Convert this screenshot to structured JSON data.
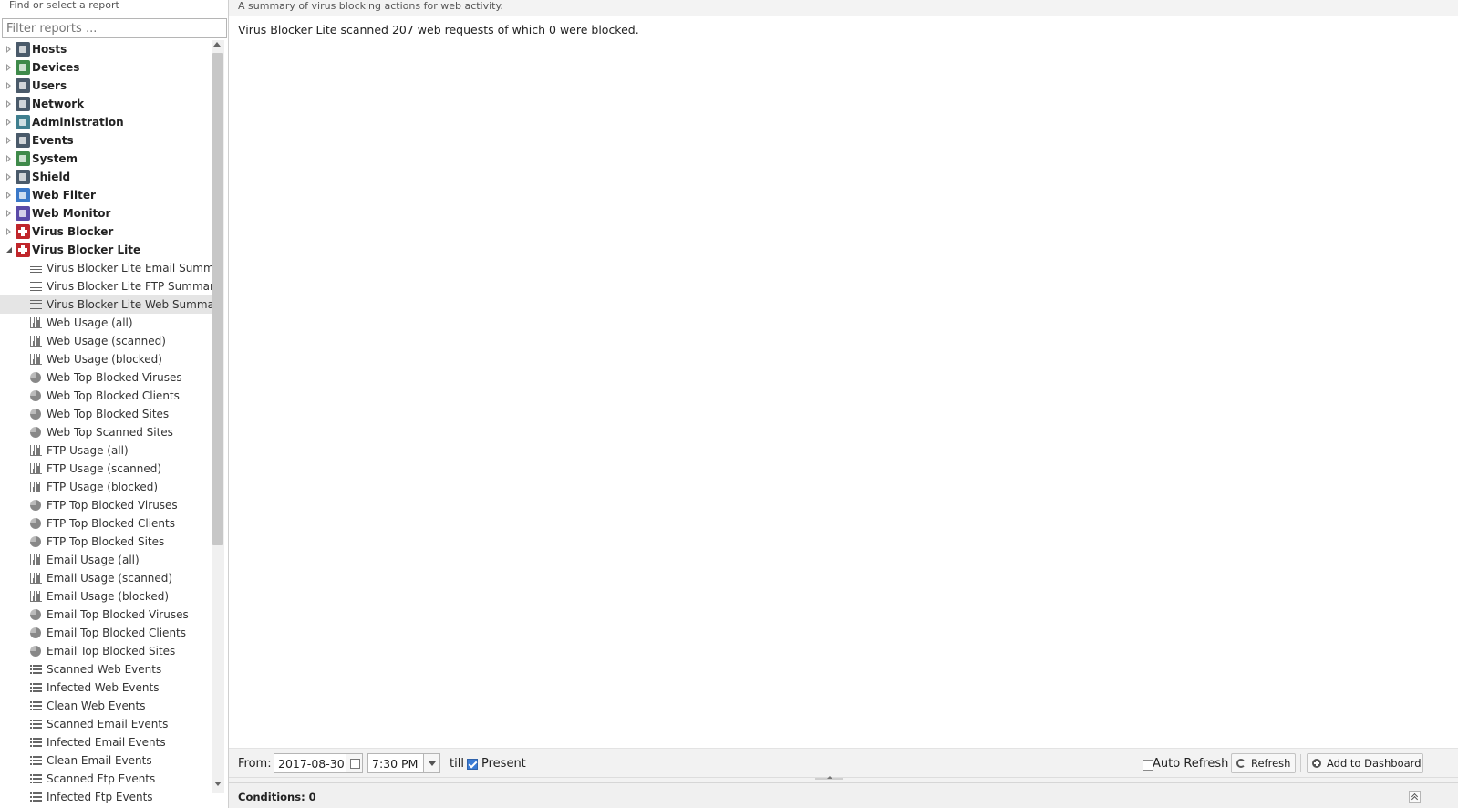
{
  "sidebar": {
    "header": "Find or select a report",
    "filter_placeholder": "Filter reports ...",
    "categories": [
      {
        "label": "Hosts",
        "icon": "hosts-icon"
      },
      {
        "label": "Devices",
        "icon": "devices-icon"
      },
      {
        "label": "Users",
        "icon": "users-icon"
      },
      {
        "label": "Network",
        "icon": "network-icon"
      },
      {
        "label": "Administration",
        "icon": "administration-icon"
      },
      {
        "label": "Events",
        "icon": "events-icon"
      },
      {
        "label": "System",
        "icon": "system-icon"
      },
      {
        "label": "Shield",
        "icon": "shield-icon"
      },
      {
        "label": "Web Filter",
        "icon": "web-filter-icon"
      },
      {
        "label": "Web Monitor",
        "icon": "web-monitor-icon"
      },
      {
        "label": "Virus Blocker",
        "icon": "virus-blocker-icon"
      },
      {
        "label": "Virus Blocker Lite",
        "icon": "virus-blocker-lite-icon",
        "expanded": true
      }
    ],
    "reports": [
      {
        "label": "Virus Blocker Lite Email Summary",
        "type": "text"
      },
      {
        "label": "Virus Blocker Lite FTP Summary",
        "type": "text"
      },
      {
        "label": "Virus Blocker Lite Web Summary",
        "type": "text",
        "selected": true
      },
      {
        "label": "Web Usage (all)",
        "type": "bar"
      },
      {
        "label": "Web Usage (scanned)",
        "type": "bar"
      },
      {
        "label": "Web Usage (blocked)",
        "type": "bar"
      },
      {
        "label": "Web Top Blocked Viruses",
        "type": "pie"
      },
      {
        "label": "Web Top Blocked Clients",
        "type": "pie"
      },
      {
        "label": "Web Top Blocked Sites",
        "type": "pie"
      },
      {
        "label": "Web Top Scanned Sites",
        "type": "pie"
      },
      {
        "label": "FTP Usage (all)",
        "type": "bar"
      },
      {
        "label": "FTP Usage (scanned)",
        "type": "bar"
      },
      {
        "label": "FTP Usage (blocked)",
        "type": "bar"
      },
      {
        "label": "FTP Top Blocked Viruses",
        "type": "pie"
      },
      {
        "label": "FTP Top Blocked Clients",
        "type": "pie"
      },
      {
        "label": "FTP Top Blocked Sites",
        "type": "pie"
      },
      {
        "label": "Email Usage (all)",
        "type": "bar"
      },
      {
        "label": "Email Usage (scanned)",
        "type": "bar"
      },
      {
        "label": "Email Usage (blocked)",
        "type": "bar"
      },
      {
        "label": "Email Top Blocked Viruses",
        "type": "pie"
      },
      {
        "label": "Email Top Blocked Clients",
        "type": "pie"
      },
      {
        "label": "Email Top Blocked Sites",
        "type": "pie"
      },
      {
        "label": "Scanned Web Events",
        "type": "list"
      },
      {
        "label": "Infected Web Events",
        "type": "list"
      },
      {
        "label": "Clean Web Events",
        "type": "list"
      },
      {
        "label": "Scanned Email Events",
        "type": "list"
      },
      {
        "label": "Infected Email Events",
        "type": "list"
      },
      {
        "label": "Clean Email Events",
        "type": "list"
      },
      {
        "label": "Scanned Ftp Events",
        "type": "list"
      },
      {
        "label": "Infected Ftp Events",
        "type": "list"
      }
    ]
  },
  "main": {
    "description": "A summary of virus blocking actions for web activity.",
    "summary": "Virus Blocker Lite scanned 207 web requests of which 0 were blocked."
  },
  "toolbar": {
    "from_label": "From:",
    "from_date": "2017-08-30",
    "from_time": "7:30 PM",
    "till_label": "till",
    "present_label": "Present",
    "present_checked": true,
    "auto_refresh_label": "Auto Refresh",
    "auto_refresh_checked": false,
    "refresh_label": "Refresh",
    "add_dashboard_label": "Add to Dashboard"
  },
  "conditions": {
    "label": "Conditions: 0"
  }
}
